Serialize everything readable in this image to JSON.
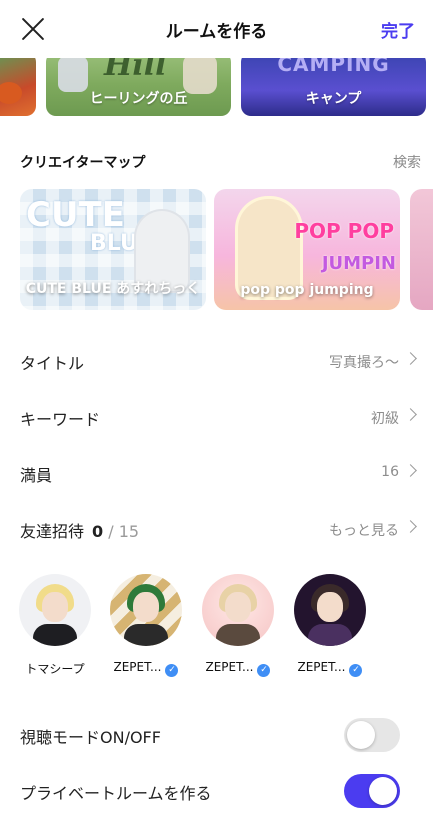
{
  "header": {
    "title": "ルームを作る",
    "done_label": "完了"
  },
  "top_cards": [
    {
      "label": ""
    },
    {
      "label": "ヒーリングの丘",
      "art_text": "Hill"
    },
    {
      "label": "キャンプ",
      "art_text": "CAMPING"
    }
  ],
  "creator_maps": {
    "title": "クリエイターマップ",
    "search_label": "検索",
    "cards": [
      {
        "label": "CUTE BLUE あすれちっく",
        "art_text_1": "CUTE",
        "art_text_2": "BLUE"
      },
      {
        "label": "pop pop jumping",
        "art_text_1": "POP POP",
        "art_text_2": "JUMPIN"
      }
    ]
  },
  "settings": {
    "title_row": {
      "label": "タイトル",
      "value": "写真撮ろ〜"
    },
    "keyword_row": {
      "label": "キーワード",
      "value": "初級"
    },
    "capacity_row": {
      "label": "満員",
      "value": "16"
    },
    "invite_row": {
      "label": "友達招待",
      "count": "0",
      "total": "/ 15",
      "more_label": "もっと見る"
    }
  },
  "friends": [
    {
      "name": "トマシープ",
      "verified": false
    },
    {
      "name": "ZEPET...",
      "verified": true
    },
    {
      "name": "ZEPET...",
      "verified": true
    },
    {
      "name": "ZEPET...",
      "verified": true
    }
  ],
  "toggles": {
    "viewing_mode": {
      "label": "視聴モードON/OFF",
      "on": false
    },
    "private_room": {
      "label": "プライベートルームを作る",
      "on": true
    }
  },
  "colors": {
    "accent": "#4b3cf0",
    "verified": "#3f8ef5",
    "muted_text": "#8d8d8d"
  }
}
